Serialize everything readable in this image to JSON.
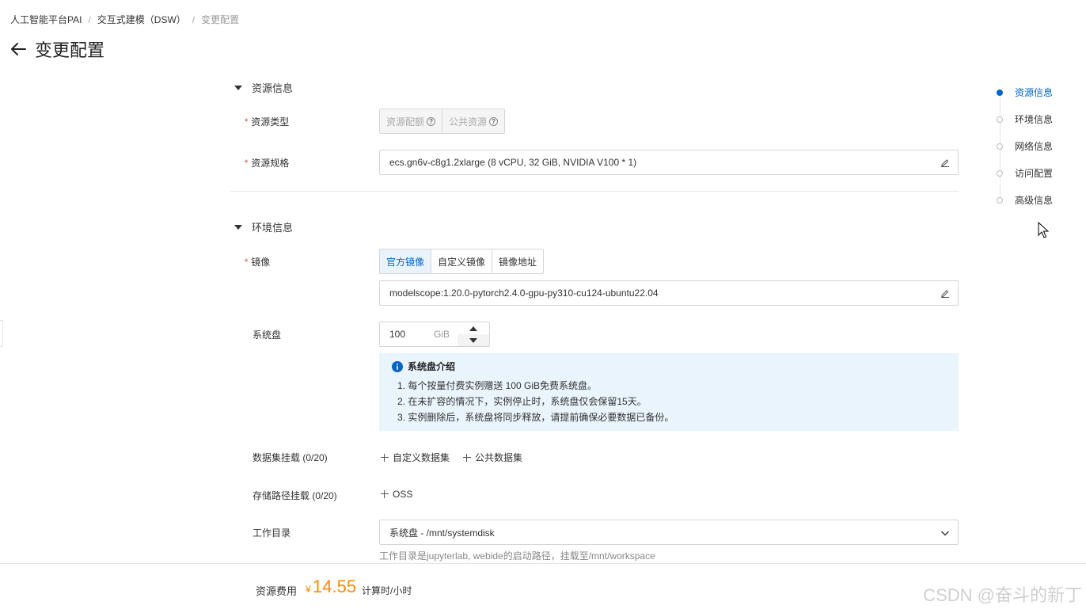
{
  "breadcrumb": {
    "items": [
      "人工智能平台PAI",
      "交互式建模（DSW）",
      "变更配置"
    ]
  },
  "header": {
    "title": "变更配置"
  },
  "sections": {
    "resource": {
      "title": "资源信息"
    },
    "environment": {
      "title": "环境信息"
    }
  },
  "resource": {
    "type_label": "资源类型",
    "type_options": [
      "资源配额",
      "公共资源"
    ],
    "spec_label": "资源规格",
    "spec_value": "ecs.gn6v-c8g1.2xlarge  (8 vCPU, 32 GiB, NVIDIA V100 * 1)"
  },
  "environment": {
    "image_label": "镜像",
    "image_tabs": [
      "官方镜像",
      "自定义镜像",
      "镜像地址"
    ],
    "image_value": "modelscope:1.20.0-pytorch2.4.0-gpu-py310-cu124-ubuntu22.04",
    "disk_label": "系统盘",
    "disk_value": "100",
    "disk_unit": "GiB",
    "notice": {
      "title": "系统盘介绍",
      "items": [
        "1. 每个按量付费实例赠送 100 GiB免费系统盘。",
        "2. 在未扩容的情况下，实例停止时，系统盘仅会保留15天。",
        "3. 实例删除后，系统盘将同步释放，请提前确保必要数据已备份。"
      ]
    },
    "dataset_label": "数据集挂载 (0/20)",
    "dataset_actions": [
      "自定义数据集",
      "公共数据集"
    ],
    "storage_label": "存储路径挂载 (0/20)",
    "storage_action": "OSS",
    "workdir_label": "工作目录",
    "workdir_value": "系统盘 - /mnt/systemdisk",
    "workdir_hint": "工作目录是jupyterlab, webide的启动路径，挂载至/mnt/workspace"
  },
  "anchor_nav": {
    "items": [
      "资源信息",
      "环境信息",
      "网络信息",
      "访问配置",
      "高级信息"
    ],
    "active_index": 0
  },
  "footer": {
    "cost_label": "资源费用",
    "currency": "¥",
    "amount": "14.55",
    "unit": "计算时/小时"
  },
  "watermark": "CSDN @奋斗的新丁",
  "colors": {
    "accent": "#0064c8",
    "price": "#ff8a00",
    "required": "#e8352b",
    "notice_bg": "#e9f4fd"
  }
}
